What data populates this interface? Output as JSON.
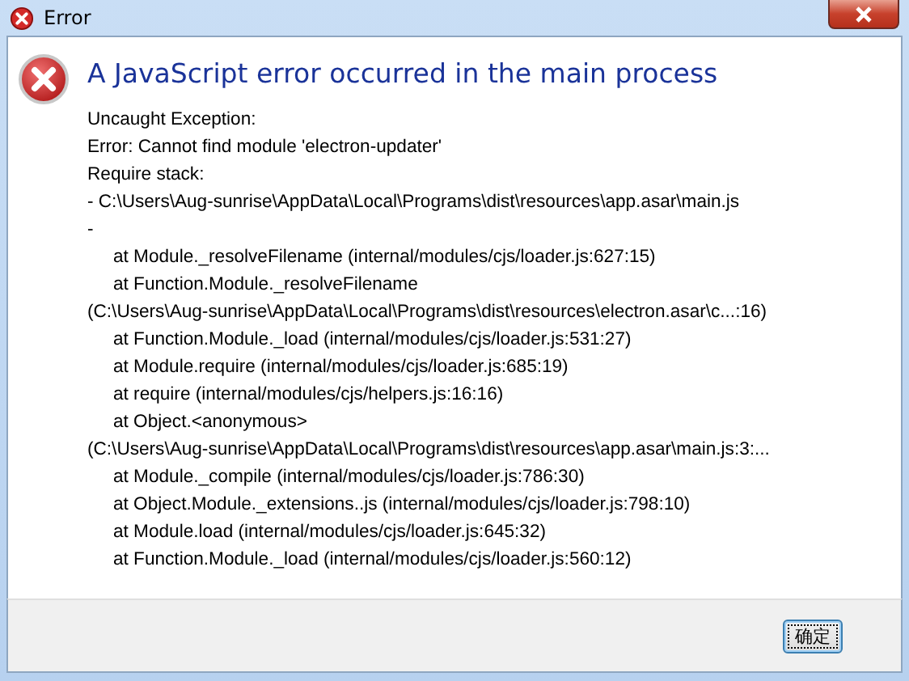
{
  "window": {
    "title": "Error"
  },
  "heading": "A JavaScript error occurred in the main process",
  "lines": [
    {
      "text": "Uncaught Exception:",
      "indented": false
    },
    {
      "text": "Error: Cannot find module 'electron-updater'",
      "indented": false
    },
    {
      "text": "Require stack:",
      "indented": false
    },
    {
      "text": "- C:\\Users\\Aug-sunrise\\AppData\\Local\\Programs\\dist\\resources\\app.asar\\main.js",
      "indented": false
    },
    {
      "text": "-",
      "indented": false
    },
    {
      "text": "at Module._resolveFilename (internal/modules/cjs/loader.js:627:15)",
      "indented": true
    },
    {
      "text": "at Function.Module._resolveFilename",
      "indented": true
    },
    {
      "text": "(C:\\Users\\Aug-sunrise\\AppData\\Local\\Programs\\dist\\resources\\electron.asar\\c...:16)",
      "indented": false
    },
    {
      "text": "at Function.Module._load (internal/modules/cjs/loader.js:531:27)",
      "indented": true
    },
    {
      "text": "at Module.require (internal/modules/cjs/loader.js:685:19)",
      "indented": true
    },
    {
      "text": "at require (internal/modules/cjs/helpers.js:16:16)",
      "indented": true
    },
    {
      "text": "at Object.<anonymous>",
      "indented": true
    },
    {
      "text": "(C:\\Users\\Aug-sunrise\\AppData\\Local\\Programs\\dist\\resources\\app.asar\\main.js:3:...",
      "indented": false
    },
    {
      "text": "at Module._compile (internal/modules/cjs/loader.js:786:30)",
      "indented": true
    },
    {
      "text": "at Object.Module._extensions..js (internal/modules/cjs/loader.js:798:10)",
      "indented": true
    },
    {
      "text": "at Module.load (internal/modules/cjs/loader.js:645:32)",
      "indented": true
    },
    {
      "text": "at Function.Module._load (internal/modules/cjs/loader.js:560:12)",
      "indented": true
    }
  ],
  "buttons": [
    {
      "label": "确定",
      "focused": true
    }
  ]
}
